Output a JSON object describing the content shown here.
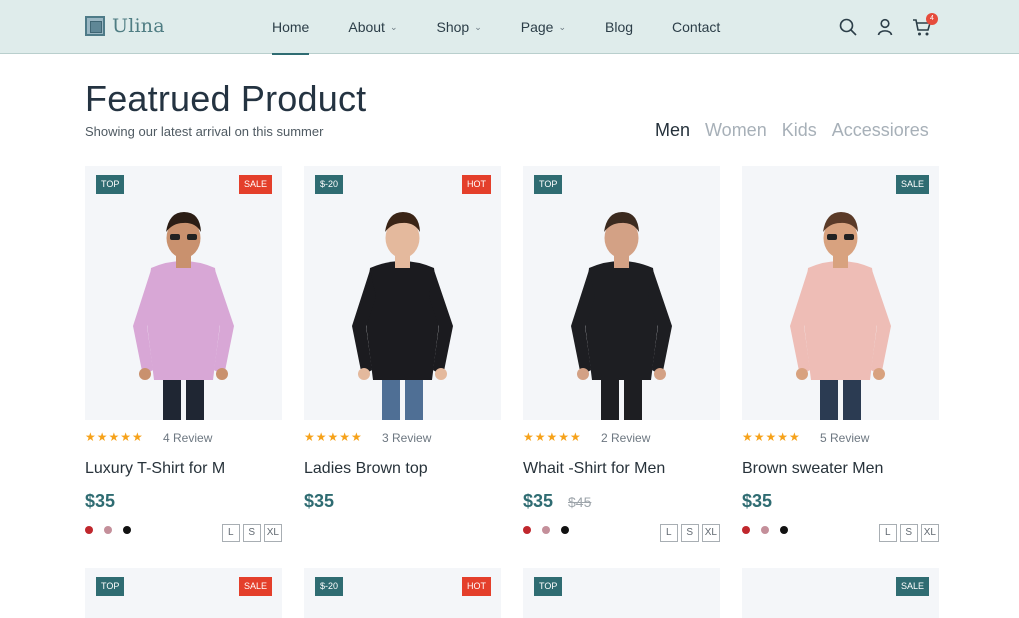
{
  "brand": {
    "name": "Ulina"
  },
  "nav": [
    {
      "label": "Home",
      "active": true,
      "dropdown": false
    },
    {
      "label": "About",
      "active": false,
      "dropdown": true
    },
    {
      "label": "Shop",
      "active": false,
      "dropdown": true
    },
    {
      "label": "Page",
      "active": false,
      "dropdown": true
    },
    {
      "label": "Blog",
      "active": false,
      "dropdown": false
    },
    {
      "label": "Contact",
      "active": false,
      "dropdown": false
    }
  ],
  "header_icons": {
    "cart_count": "4"
  },
  "section": {
    "title": "Featrued Product",
    "subtitle": "Showing our latest arrival on this summer"
  },
  "filters": [
    {
      "label": "Men",
      "active": true
    },
    {
      "label": "Women",
      "active": false
    },
    {
      "label": "Kids",
      "active": false
    },
    {
      "label": "Accessiores",
      "active": false
    }
  ],
  "colors": {
    "accent": "#2f6c72",
    "sale": "#e43f2b",
    "star": "#f6a21a"
  },
  "products": [
    {
      "left_tag": "TOP",
      "right_tag": "SALE",
      "right_tag_color": "red",
      "stars": "★★★★★",
      "reviews": "4 Review",
      "name": "Luxury T-Shirt for M",
      "price": "$35",
      "old_price": "",
      "colors": [
        "#c0272d",
        "#c48f9a",
        "#111111"
      ],
      "sizes": [
        "L",
        "S",
        "XL"
      ],
      "figure": {
        "shirt": "#d8a7d6",
        "pants": "#1f2633",
        "skin": "#c9916e",
        "hair": "#2b1d15",
        "glasses": true
      }
    },
    {
      "left_tag": "$-20",
      "right_tag": "HOT",
      "right_tag_color": "red",
      "stars": "★★★★★",
      "reviews": "3 Review",
      "name": "Ladies Brown top",
      "price": "$35",
      "old_price": "",
      "colors": [],
      "sizes": [],
      "figure": {
        "shirt": "#1b1b1f",
        "pants": "#4f6f95",
        "skin": "#e4b99d",
        "hair": "#3a2416",
        "glasses": false
      }
    },
    {
      "left_tag": "TOP",
      "right_tag": "",
      "right_tag_color": "",
      "stars": "★★★★★",
      "reviews": "2 Review",
      "name": "Whait -Shirt for Men",
      "price": "$35",
      "old_price": "$45",
      "colors": [
        "#c0272d",
        "#c48f9a",
        "#111111"
      ],
      "sizes": [
        "L",
        "S",
        "XL"
      ],
      "figure": {
        "shirt": "#1d1e22",
        "pants": "#1d1e22",
        "skin": "#d3a185",
        "hair": "#3b2a1f",
        "glasses": false
      }
    },
    {
      "left_tag": "",
      "right_tag": "SALE",
      "right_tag_color": "teal",
      "stars": "★★★★★",
      "reviews": "5 Review",
      "name": "Brown sweater Men",
      "price": "$35",
      "old_price": "",
      "colors": [
        "#c0272d",
        "#c48f9a",
        "#111111"
      ],
      "sizes": [
        "L",
        "S",
        "XL"
      ],
      "figure": {
        "shirt": "#eebdb6",
        "pants": "#2b3b52",
        "skin": "#d8a27f",
        "hair": "#5a3a28",
        "glasses": true
      }
    }
  ],
  "second_row_tags": [
    {
      "left_tag": "TOP",
      "right_tag": "SALE",
      "right_tag_color": "red"
    },
    {
      "left_tag": "$-20",
      "right_tag": "HOT",
      "right_tag_color": "red"
    },
    {
      "left_tag": "TOP",
      "right_tag": "",
      "right_tag_color": ""
    },
    {
      "left_tag": "",
      "right_tag": "SALE",
      "right_tag_color": "teal"
    }
  ]
}
